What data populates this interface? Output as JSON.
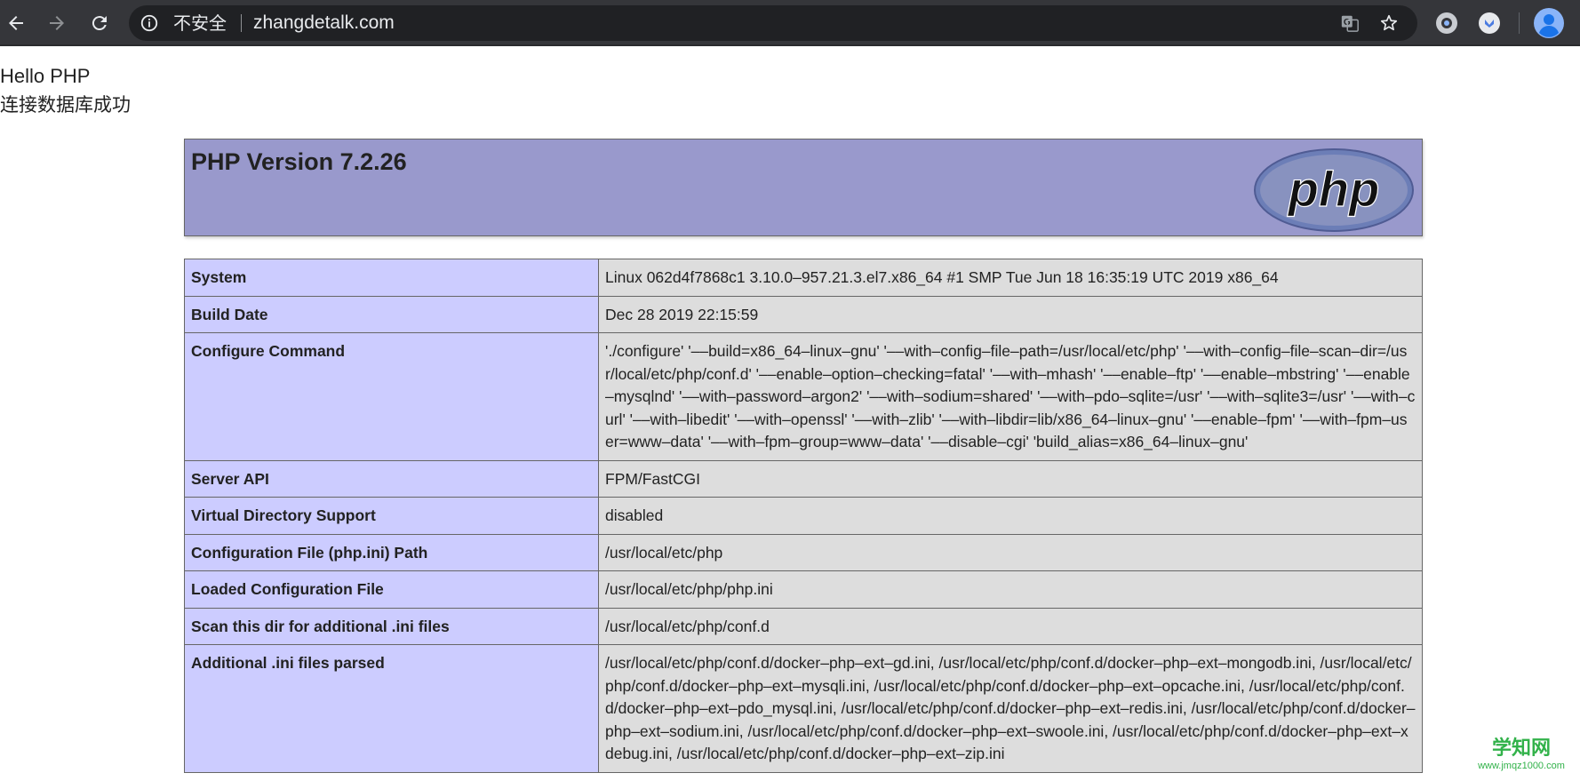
{
  "browser": {
    "security_label": "不安全",
    "url": "zhangdetalk.com"
  },
  "page": {
    "line1": "Hello PHP",
    "line2": "连接数据库成功"
  },
  "phpinfo": {
    "version_title": "PHP Version 7.2.26",
    "logo_text": "php",
    "rows": [
      {
        "key": "System",
        "value": "Linux 062d4f7868c1 3.10.0–957.21.3.el7.x86_64 #1 SMP Tue Jun 18 16:35:19 UTC 2019 x86_64"
      },
      {
        "key": "Build Date",
        "value": "Dec 28 2019 22:15:59"
      },
      {
        "key": "Configure Command",
        "value": "'./configure' '––build=x86_64–linux–gnu' '––with–config–file–path=/usr/local/etc/php' '––with–config–file–scan–dir=/usr/local/etc/php/conf.d' '––enable–option–checking=fatal' '––with–mhash' '––enable–ftp' '––enable–mbstring' '––enable–mysqlnd' '––with–password–argon2' '––with–sodium=shared' '––with–pdo–sqlite=/usr' '––with–sqlite3=/usr' '––with–curl' '––with–libedit' '––with–openssl' '––with–zlib' '––with–libdir=lib/x86_64–linux–gnu' '––enable–fpm' '––with–fpm–user=www–data' '––with–fpm–group=www–data' '––disable–cgi' 'build_alias=x86_64–linux–gnu'"
      },
      {
        "key": "Server API",
        "value": "FPM/FastCGI"
      },
      {
        "key": "Virtual Directory Support",
        "value": "disabled"
      },
      {
        "key": "Configuration File (php.ini) Path",
        "value": "/usr/local/etc/php"
      },
      {
        "key": "Loaded Configuration File",
        "value": "/usr/local/etc/php/php.ini"
      },
      {
        "key": "Scan this dir for additional .ini files",
        "value": "/usr/local/etc/php/conf.d"
      },
      {
        "key": "Additional .ini files parsed",
        "value": "/usr/local/etc/php/conf.d/docker–php–ext–gd.ini, /usr/local/etc/php/conf.d/docker–php–ext–mongodb.ini, /usr/local/etc/php/conf.d/docker–php–ext–mysqli.ini, /usr/local/etc/php/conf.d/docker–php–ext–opcache.ini, /usr/local/etc/php/conf.d/docker–php–ext–pdo_mysql.ini, /usr/local/etc/php/conf.d/docker–php–ext–redis.ini, /usr/local/etc/php/conf.d/docker–php–ext–sodium.ini, /usr/local/etc/php/conf.d/docker–php–ext–swoole.ini, /usr/local/etc/php/conf.d/docker–php–ext–xdebug.ini, /usr/local/etc/php/conf.d/docker–php–ext–zip.ini"
      }
    ]
  },
  "watermark": {
    "brand": "学知网",
    "site": "www.jmqz1000.com"
  }
}
